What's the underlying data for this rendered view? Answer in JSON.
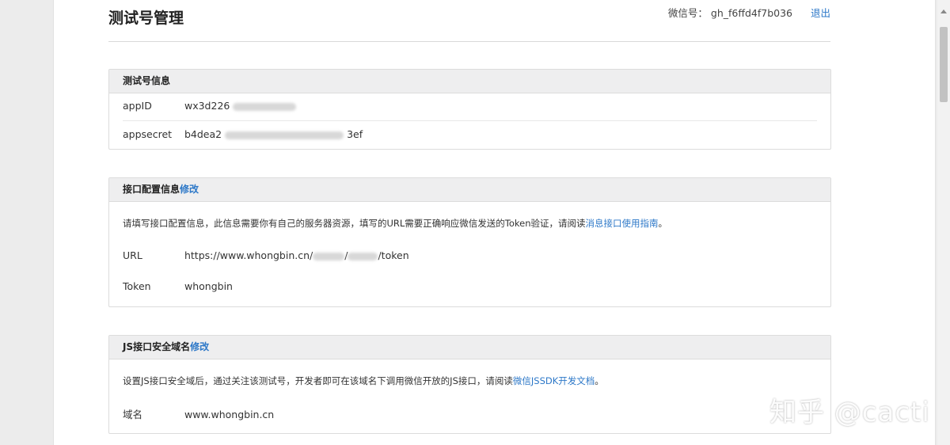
{
  "header": {
    "title": "测试号管理",
    "account_label": "微信号：",
    "account_id": "gh_f6ffd4f7b036",
    "logout": "退出"
  },
  "test_info": {
    "title": "测试号信息",
    "appid_label": "appID",
    "appid_prefix": "wx3d226",
    "appid_suffix": "",
    "appsecret_label": "appsecret",
    "appsecret_prefix": "b4dea2",
    "appsecret_suffix": "3ef"
  },
  "api_config": {
    "title": "接口配置信息",
    "edit": "修改",
    "desc": "请填写接口配置信息，此信息需要你有自己的服务器资源，填写的URL需要正确响应微信发送的Token验证，请阅读",
    "desc_link": "消息接口使用指南",
    "desc_end": "。",
    "url_label": "URL",
    "url_prefix": "https://www.whongbin.cn/",
    "url_mid": "/",
    "url_suffix": "/token",
    "token_label": "Token",
    "token_value": "whongbin"
  },
  "js_domain": {
    "title": "JS接口安全域名",
    "edit": "修改",
    "desc": "设置JS接口安全域后，通过关注该测试号，开发者即可在该域名下调用微信开放的JS接口，请阅读",
    "desc_link": "微信JSSDK开发文档",
    "desc_end": "。",
    "domain_label": "域名",
    "domain_value": "www.whongbin.cn"
  },
  "watermark": "知乎 @cacti"
}
